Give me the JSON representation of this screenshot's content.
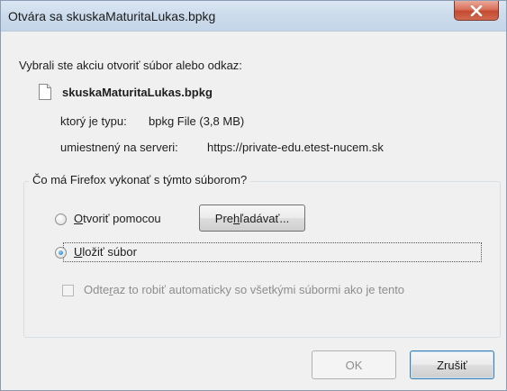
{
  "window": {
    "title": "Otvára sa skuskaMaturitaLukas.bpkg",
    "close_glyph": "✕"
  },
  "dialog": {
    "intro": "Vybrali ste akciu otvoriť súbor alebo odkaz:",
    "file_name": "skuskaMaturitaLukas.bpkg",
    "file_icon": "document-icon",
    "type_label": "ktorý je typu:",
    "type_value": "bpkg File (3,8 MB)",
    "server_label": "umiestnený na serveri:",
    "server_value": "https://private-edu.etest-nucem.sk"
  },
  "action_group": {
    "legend": "Čo má Firefox vykonať s týmto súborom?",
    "open_with": {
      "mnemonic": "O",
      "rest": "tvoriť pomocou",
      "selected": false
    },
    "browse_button": {
      "pre": "Pre",
      "mnemonic": "h",
      "post": "ľadávať..."
    },
    "save_file": {
      "mnemonic": "U",
      "rest": "ložiť súbor",
      "selected": true
    },
    "auto_checkbox": {
      "pre": "Odte",
      "mnemonic": "r",
      "post": "az to robiť automaticky so všetkými súbormi ako je tento",
      "checked": false,
      "enabled": false
    }
  },
  "buttons": {
    "ok": "OK",
    "cancel": "Zrušiť"
  }
}
